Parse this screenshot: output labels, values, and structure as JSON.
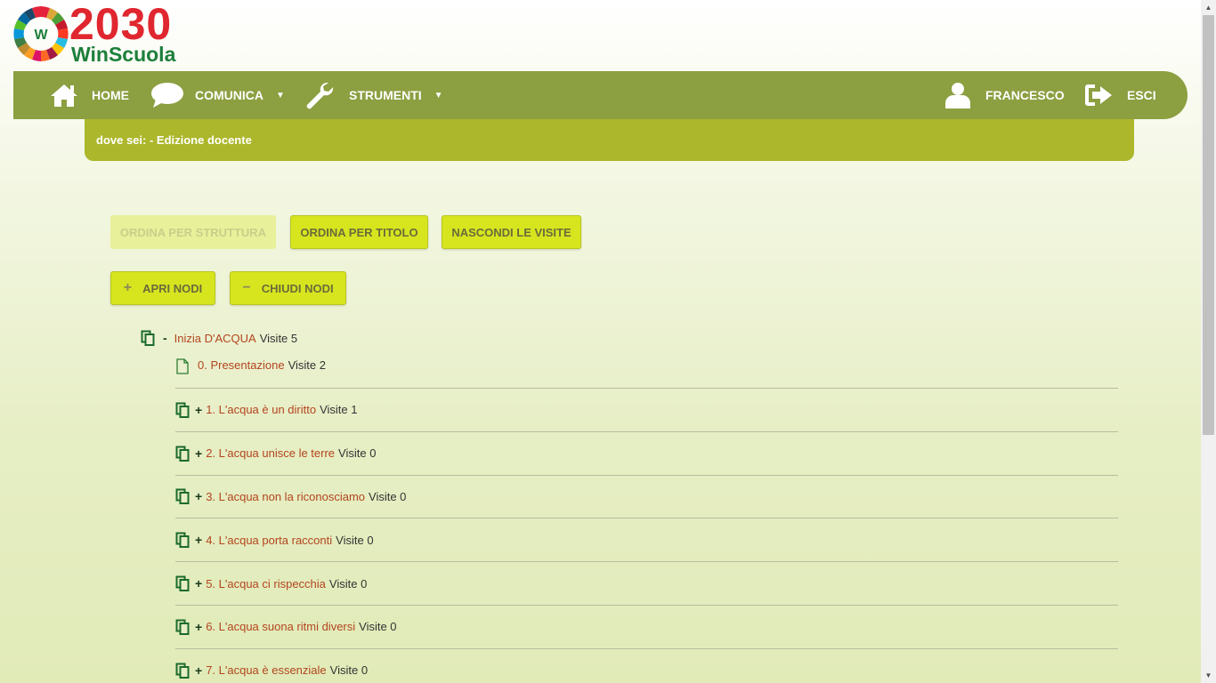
{
  "logo": {
    "title": "2030",
    "subtitle": "WinScuola",
    "badge_letter": "W"
  },
  "nav": {
    "home": "HOME",
    "communica": "COMUNICA",
    "strumenti": "STRUMENTI",
    "user": "FRANCESCO",
    "logout": "ESCI"
  },
  "breadcrumb": "dove sei: - Edizione docente",
  "buttons": {
    "sort_structure": "ORDINA PER STRUTTURA",
    "sort_title": "ORDINA PER TITOLO",
    "hide_visits": "NASCONDI LE VISITE",
    "open_nodes": "APRI NODI",
    "close_nodes": "CHIUDI NODI",
    "plus": "+",
    "minus": "−"
  },
  "tree": {
    "root": {
      "title": "Inizia D'ACQUA",
      "visits": "Visite 5",
      "toggle": "-"
    },
    "children": [
      {
        "title": "0. Presentazione",
        "visits": "Visite 2",
        "toggle": ""
      },
      {
        "title": "1. L'acqua è un diritto",
        "visits": "Visite 1",
        "toggle": "+"
      },
      {
        "title": "2. L'acqua unisce le terre",
        "visits": "Visite 0",
        "toggle": "+"
      },
      {
        "title": "3. L'acqua non la riconosciamo",
        "visits": "Visite 0",
        "toggle": "+"
      },
      {
        "title": "4. L'acqua porta racconti",
        "visits": "Visite 0",
        "toggle": "+"
      },
      {
        "title": "5. L'acqua ci rispecchia",
        "visits": "Visite 0",
        "toggle": "+"
      },
      {
        "title": "6. L'acqua suona ritmi diversi",
        "visits": "Visite 0",
        "toggle": "+"
      },
      {
        "title": "7. L'acqua è essenziale",
        "visits": "Visite 0",
        "toggle": "+"
      }
    ]
  },
  "colors": {
    "nav_bg": "#8c9f41",
    "breadcrumb_bg": "#acb72b",
    "button_bg": "#d7e51f",
    "link": "#b3451e",
    "icon_green": "#1c7f3a"
  }
}
